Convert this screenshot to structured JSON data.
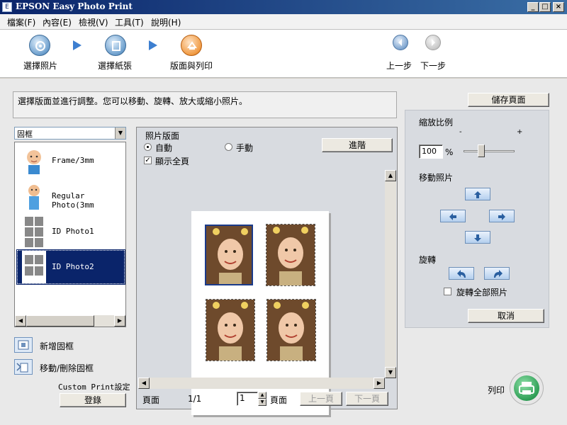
{
  "window": {
    "title": "EPSON Easy Photo Print"
  },
  "menu": [
    "檔案(F)",
    "內容(E)",
    "檢視(V)",
    "工具(T)",
    "說明(H)"
  ],
  "wizard": {
    "steps": [
      {
        "label": "選擇照片",
        "state": "done"
      },
      {
        "label": "選擇紙張",
        "state": "done"
      },
      {
        "label": "版面與列印",
        "state": "active"
      }
    ],
    "prev_label": "上一步",
    "next_label": "下一步"
  },
  "main": {
    "instruction": "選擇版面並進行調整。您可以移動、旋轉、放大或縮小照片。",
    "save_page": "儲存頁面"
  },
  "frames": {
    "combo_value": "固框",
    "items": [
      {
        "label": "Frame/3mm",
        "thumb": "baby-photo"
      },
      {
        "label": "Regular Photo(3mm",
        "thumb": "toddler-photo"
      },
      {
        "label": "ID Photo1",
        "thumb": "grid-layout"
      },
      {
        "label": "ID Photo2",
        "thumb": "grid-layout",
        "selected": true
      }
    ],
    "add_frame": "新增固框",
    "move_delete_frame": "移動/刪除固框",
    "custom_print": "Custom Print設定",
    "register": "登錄"
  },
  "layout": {
    "group_label": "照片版面",
    "auto_label": "自動",
    "manual_label": "手動",
    "mode": "auto",
    "advanced_label": "進階",
    "show_full_page": "顯示全頁",
    "show_full_page_checked": true,
    "page_label": "頁面",
    "page_count": "1/1",
    "page_input": "1",
    "page_unit": "頁面",
    "prev_page": "上一頁",
    "next_page": "下一頁"
  },
  "adjust": {
    "zoom_label": "縮放比例",
    "minus": "-",
    "plus": "+",
    "zoom_value": "100",
    "percent": "%",
    "move_label": "移動照片",
    "rotate_label": "旋轉",
    "rotate_all": "旋轉全部照片",
    "rotate_all_checked": false,
    "cancel": "取消"
  },
  "print": {
    "label": "列印"
  },
  "colors": {
    "title_bar": "#0a246a",
    "active_step": "#f09a43",
    "selection": "#0a246a",
    "print_button": "#2e9e55"
  }
}
